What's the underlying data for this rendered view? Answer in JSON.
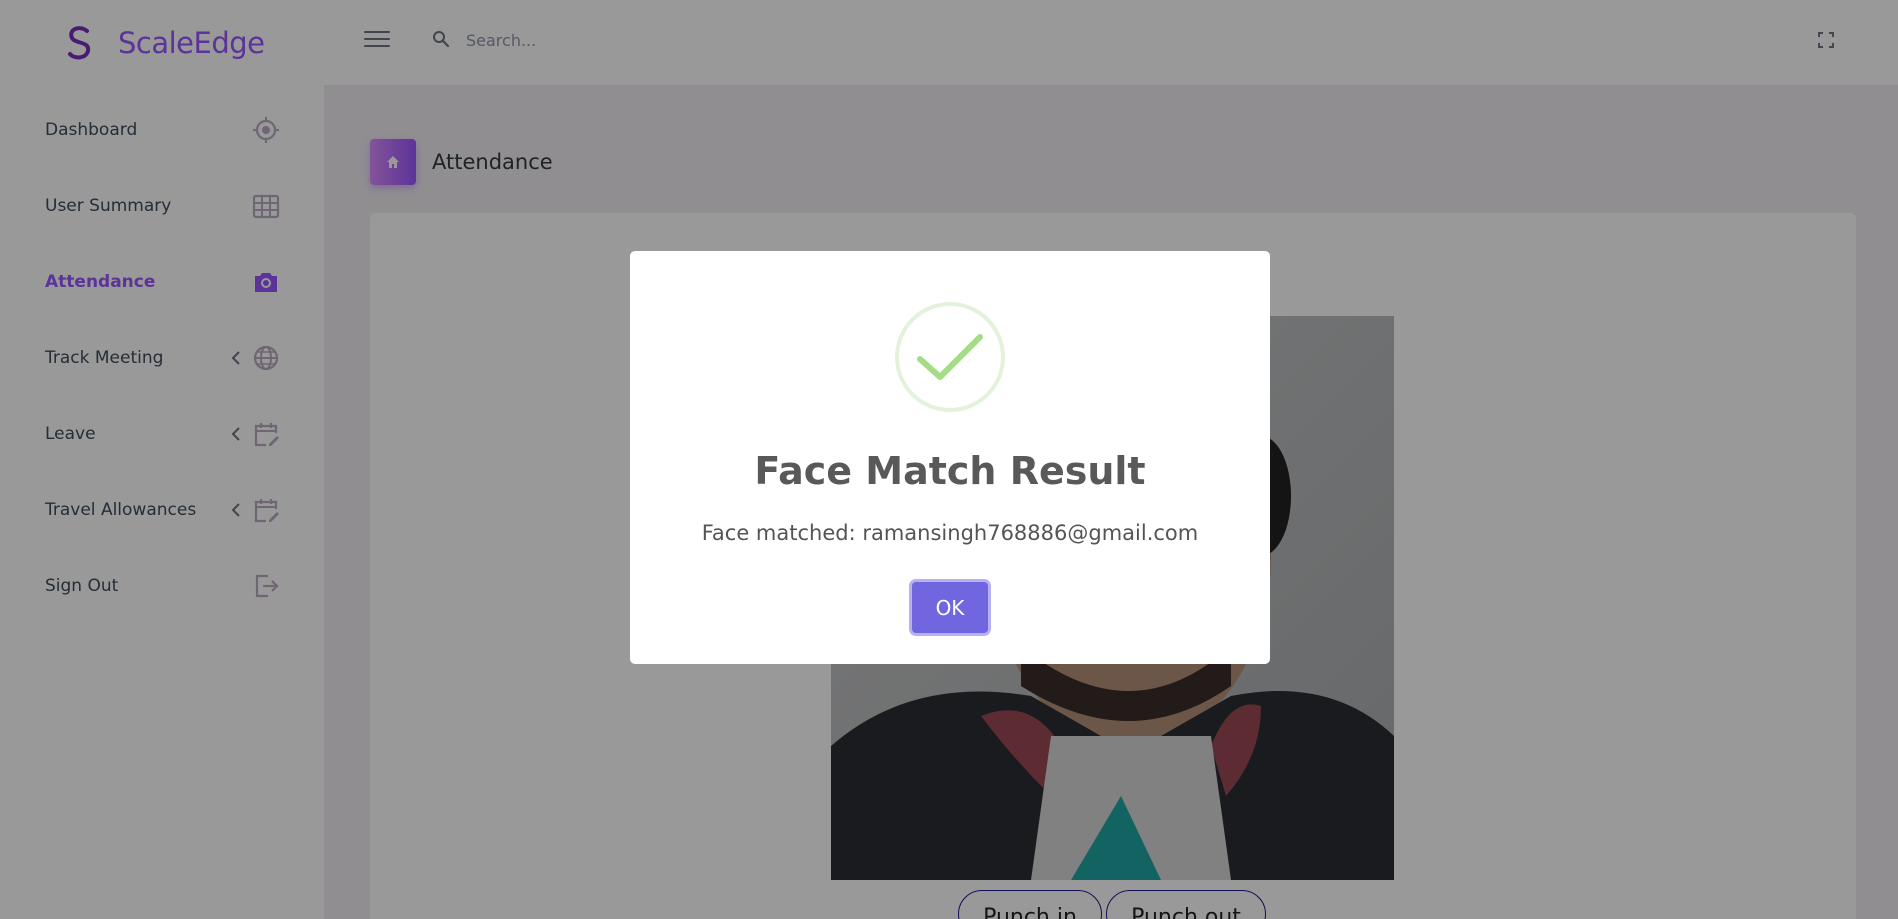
{
  "brand": {
    "name": "ScaleEdge"
  },
  "search": {
    "placeholder": "Search..."
  },
  "sidebar": {
    "items": [
      {
        "label": "Dashboard",
        "icon": "crosshairs-icon",
        "active": false,
        "has_arrow": false
      },
      {
        "label": "User Summary",
        "icon": "table-icon",
        "active": false,
        "has_arrow": false
      },
      {
        "label": "Attendance",
        "icon": "camera-icon",
        "active": true,
        "has_arrow": false
      },
      {
        "label": "Track Meeting",
        "icon": "globe-icon",
        "active": false,
        "has_arrow": true
      },
      {
        "label": "Leave",
        "icon": "calendar-edit-icon",
        "active": false,
        "has_arrow": true
      },
      {
        "label": "Travel Allowances",
        "icon": "calendar-edit-icon",
        "active": false,
        "has_arrow": true
      },
      {
        "label": "Sign Out",
        "icon": "logout-icon",
        "active": false,
        "has_arrow": false
      }
    ]
  },
  "page": {
    "title": "Attendance"
  },
  "buttons": {
    "punch_in": "Punch in",
    "punch_out": "Punch out"
  },
  "modal": {
    "title": "Face Match Result",
    "text": "Face matched: ramansingh768886@gmail.com",
    "ok_label": "OK"
  },
  "colors": {
    "accent": "#9a55ff",
    "success": "#a5dc86",
    "confirm": "#7066e0",
    "overlay": "rgba(0,0,0,0.4)"
  }
}
